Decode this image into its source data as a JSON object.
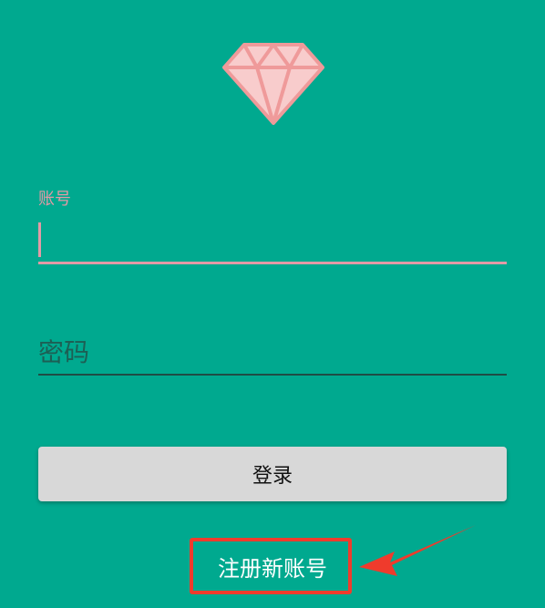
{
  "colors": {
    "background": "#00a98f",
    "accent_pink": "#e39aa6",
    "button_bg": "#d8d8d8",
    "highlight_red": "#ef3b2c"
  },
  "logo": {
    "icon": "diamond-icon"
  },
  "form": {
    "account_label": "账号",
    "account_value": "",
    "password_placeholder": "密码",
    "password_value": "",
    "login_label": "登录",
    "register_label": "注册新账号"
  },
  "annotation": {
    "icon": "arrow-icon"
  }
}
